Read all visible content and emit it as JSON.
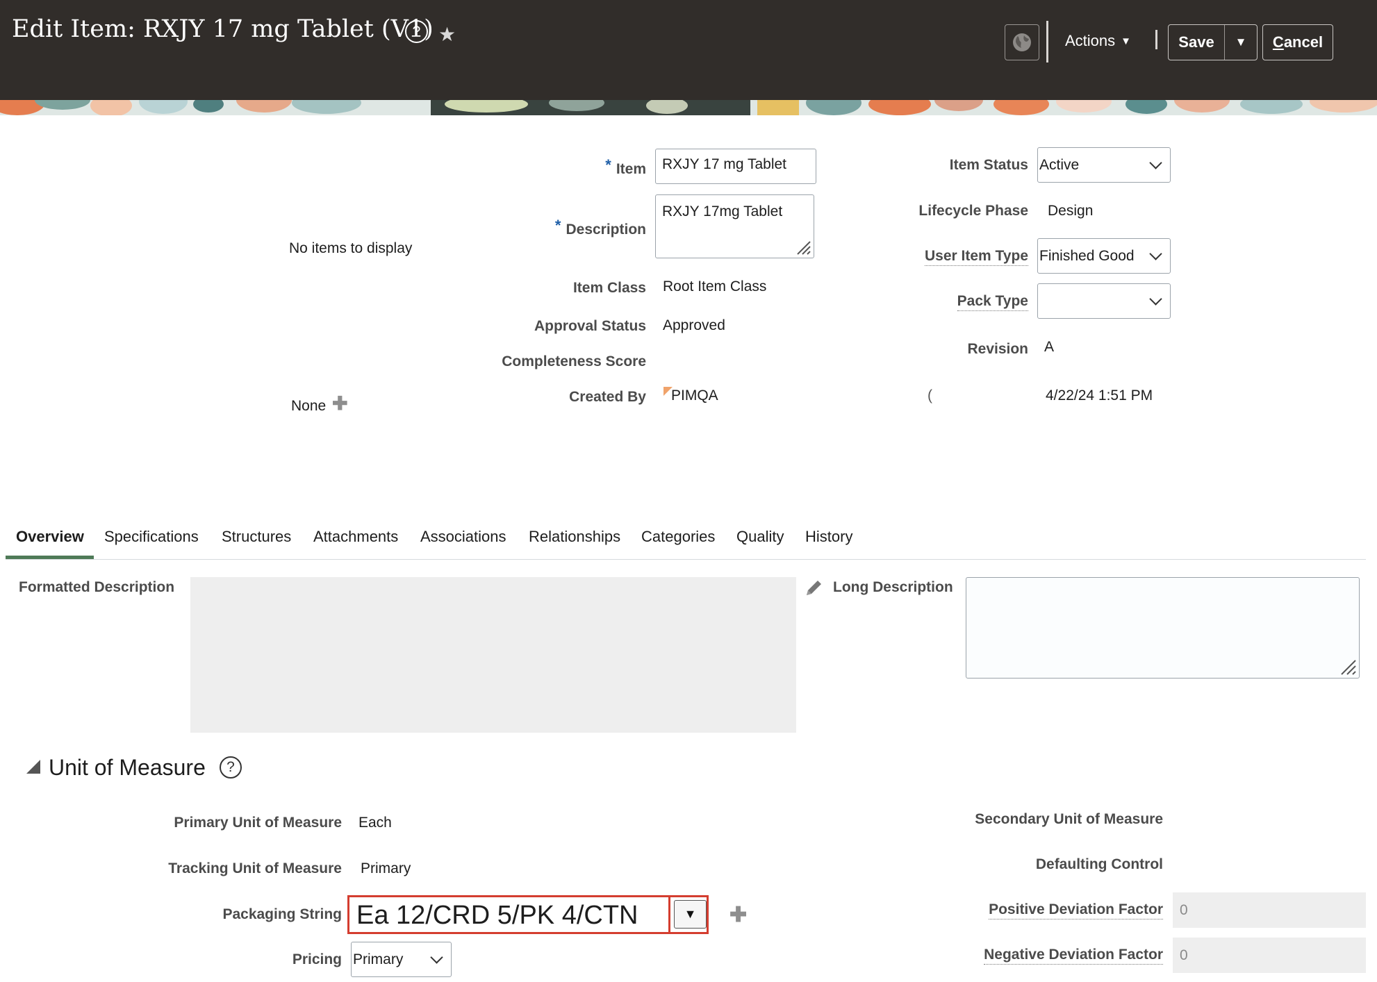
{
  "header": {
    "title": "Edit Item: RXJY 17 mg Tablet (V1)",
    "help_glyph": "?",
    "star_glyph": "★",
    "actions_label": "Actions",
    "actions_caret": "▼",
    "save_label": "Save",
    "save_menu_caret": "▼",
    "cancel_first": "C",
    "cancel_rest": "ancel"
  },
  "left_panel": {
    "no_items": "No items to display",
    "none_label": "None",
    "add_glyph": "✚"
  },
  "item_form": {
    "required_mark": "*",
    "item_label": "Item",
    "item_value": "RXJY 17 mg Tablet",
    "description_label": "Description",
    "description_value": "RXJY 17mg Tablet",
    "item_class_label": "Item Class",
    "item_class_value": "Root Item Class",
    "approval_status_label": "Approval Status",
    "approval_status_value": "Approved",
    "completeness_score_label": "Completeness Score",
    "created_by_label": "Created By",
    "created_by_value": "PIMQA"
  },
  "status_form": {
    "item_status_label": "Item Status",
    "item_status_value": "Active",
    "lifecycle_phase_label": "Lifecycle Phase",
    "lifecycle_phase_value": "Design",
    "user_item_type_label": "User Item Type",
    "user_item_type_value": "Finished Good",
    "pack_type_label": "Pack Type",
    "pack_type_value": "",
    "revision_label": "Revision",
    "revision_value": "A",
    "partial_label": "(",
    "creation_date_value": "4/22/24 1:51 PM"
  },
  "tabs": [
    "Overview",
    "Specifications",
    "Structures",
    "Attachments",
    "Associations",
    "Relationships",
    "Categories",
    "Quality",
    "History"
  ],
  "overview": {
    "formatted_description_label": "Formatted Description",
    "long_description_label": "Long Description",
    "long_description_value": ""
  },
  "uom": {
    "section_title": "Unit of Measure",
    "help_glyph": "?",
    "primary_label": "Primary Unit of Measure",
    "primary_value": "Each",
    "tracking_label": "Tracking Unit of Measure",
    "tracking_value": "Primary",
    "packaging_label": "Packaging String",
    "packaging_value": "Ea 12/CRD 5/PK 4/CTN",
    "packaging_caret": "▼",
    "add_glyph": "✚",
    "pricing_label": "Pricing",
    "pricing_value": "Primary",
    "secondary_label": "Secondary Unit of Measure",
    "defaulting_label": "Defaulting Control",
    "positive_label": "Positive Deviation Factor",
    "positive_value": "0",
    "negative_label": "Negative Deviation Factor",
    "negative_value": "0"
  },
  "colors": {
    "header_bg": "#312d2a",
    "required": "#1f5fa8",
    "active_tab": "#4e7a57",
    "highlight": "#d43d2f"
  }
}
